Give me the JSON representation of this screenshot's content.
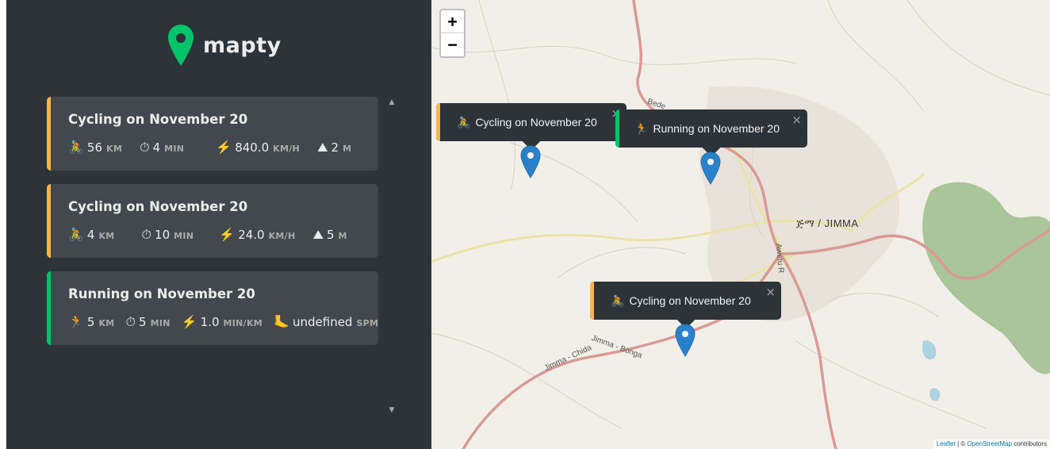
{
  "app": {
    "name": "mapty",
    "logo_icon": "map-pin-icon",
    "brand_color": "#00c46a"
  },
  "colors": {
    "cycling": "#ffb545",
    "running": "#00c46a",
    "sidebar_bg": "#2d3439",
    "card_bg": "#42484d"
  },
  "workouts": [
    {
      "type": "cycling",
      "title": "Cycling on November 20",
      "details": [
        {
          "icon": "🚴",
          "icon_name": "bicycle-icon",
          "value": "56",
          "unit": "km"
        },
        {
          "icon": "⏱",
          "icon_name": "stopwatch-icon",
          "value": "4",
          "unit": "min"
        },
        {
          "icon": "⚡️",
          "icon_name": "lightning-icon",
          "value": "840.0",
          "unit": "km/h"
        },
        {
          "icon": "⛰",
          "icon_name": "mountain-icon",
          "value": "2",
          "unit": "m"
        }
      ]
    },
    {
      "type": "cycling",
      "title": "Cycling on November 20",
      "details": [
        {
          "icon": "🚴",
          "icon_name": "bicycle-icon",
          "value": "4",
          "unit": "km"
        },
        {
          "icon": "⏱",
          "icon_name": "stopwatch-icon",
          "value": "10",
          "unit": "min"
        },
        {
          "icon": "⚡️",
          "icon_name": "lightning-icon",
          "value": "24.0",
          "unit": "km/h"
        },
        {
          "icon": "⛰",
          "icon_name": "mountain-icon",
          "value": "5",
          "unit": "m"
        }
      ]
    },
    {
      "type": "running",
      "title": "Running on November 20",
      "details": [
        {
          "icon": "🏃",
          "icon_name": "runner-icon",
          "value": "5",
          "unit": "km"
        },
        {
          "icon": "⏱",
          "icon_name": "stopwatch-icon",
          "value": "5",
          "unit": "min"
        },
        {
          "icon": "⚡️",
          "icon_name": "lightning-icon",
          "value": "1.0",
          "unit": "min/km"
        },
        {
          "icon": "🦶",
          "icon_name": "foot-icon",
          "value": "undefined",
          "unit": "spm"
        }
      ]
    }
  ],
  "map": {
    "zoom_in": "+",
    "zoom_out": "−",
    "city_label": "ጅማ / JIMMA",
    "road_label_1": "Bede",
    "road_label_2": "Jimma - Chida",
    "road_label_3": "Jimma - Bonga",
    "road_label_4": "Awetu R",
    "attribution": {
      "leaflet": "Leaflet",
      "sep": " | © ",
      "osm": "OpenStreetMap",
      "suffix": " contributors"
    },
    "popups": [
      {
        "icon": "🚴",
        "text": "Cycling on November 20",
        "type": "cycling"
      },
      {
        "icon": "🏃",
        "text": "Running on November 20",
        "type": "running"
      },
      {
        "icon": "🚴",
        "text": "Cycling on November 20",
        "type": "cycling"
      }
    ],
    "close_glyph": "×"
  }
}
